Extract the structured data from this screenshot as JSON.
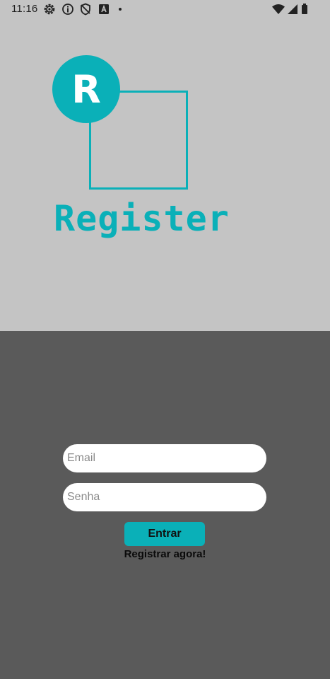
{
  "status_bar": {
    "time": "11:16",
    "left_icons": [
      "settings-icon",
      "info-icon",
      "shield-icon",
      "a-badge-icon",
      "dot-icon"
    ],
    "right_icons": [
      "wifi-icon",
      "signal-icon",
      "battery-icon"
    ]
  },
  "logo": {
    "letter": "R",
    "title": "Register",
    "color": "#0ab0b8"
  },
  "form": {
    "email_placeholder": "Email",
    "password_placeholder": "Senha",
    "submit_label": "Entrar",
    "register_link": "Registrar agora!"
  },
  "colors": {
    "top_background": "#c4c4c4",
    "bottom_background": "#5a5a5a",
    "accent": "#0ab0b8"
  }
}
